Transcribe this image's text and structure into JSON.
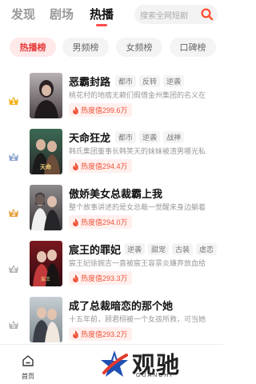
{
  "header": {
    "tabs": [
      {
        "label": "发现",
        "active": false
      },
      {
        "label": "剧场",
        "active": false
      },
      {
        "label": "热播",
        "active": true
      }
    ],
    "search": {
      "placeholder": "搜索全网短剧"
    }
  },
  "chips": [
    {
      "label": "热播榜",
      "active": true
    },
    {
      "label": "男频榜",
      "active": false
    },
    {
      "label": "女频榜",
      "active": false
    },
    {
      "label": "口碑榜",
      "active": false
    }
  ],
  "list": [
    {
      "rank": "1",
      "title": "恶霸封路",
      "tags": [
        "都市",
        "反转",
        "逆袭"
      ],
      "desc": "桃花村的地痞无赖们假借金州集团的名义在",
      "heat": "热度值299.6万",
      "rank_color": "#f2b31b"
    },
    {
      "rank": "2",
      "title": "天命狂龙",
      "tags": [
        "都市",
        "逆袭",
        "战神"
      ],
      "desc": "韩氏集团董事长韩笑天的妹妹被渣男哪光私",
      "heat": "热度值294.4万",
      "rank_color": "#8fa6cf"
    },
    {
      "rank": "3",
      "title": "傲娇美女总裁霸上我",
      "tags": [],
      "desc": "整个故事讲述的是女总裁一觉醒来身边躺着",
      "heat": "热度值294.0万",
      "rank_color": "#e8a03a"
    },
    {
      "rank": "4",
      "title": "宸王的罪妃",
      "tags": [
        "逆袭",
        "甜宠",
        "古装",
        "虐恋"
      ],
      "desc": "宸王妃徐婉吉一直被宸王容景炎嫌弃放血给",
      "heat": "热度值293.3万",
      "rank_color": "#b7b7b7"
    },
    {
      "rank": "5",
      "title": "成了总裁暗恋的那个她",
      "tags": [],
      "desc": "十五年前，顾君栩被一个女孩所救，可当她",
      "heat": "热度值293.2万",
      "rank_color": "#b7b7b7"
    }
  ],
  "bottom_nav": {
    "home_label": "首页"
  },
  "logo": {
    "text": "观驰",
    "sub": "GUANCHI"
  }
}
